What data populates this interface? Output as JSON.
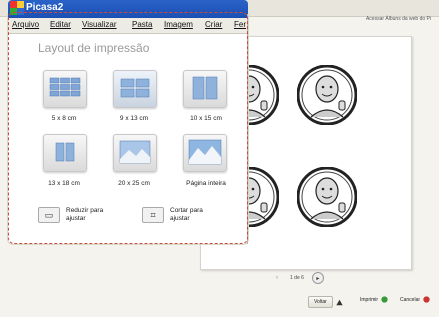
{
  "app": {
    "title": "Picasa2"
  },
  "menu": [
    "Arquivo",
    "Editar",
    "Visualizar",
    "Pasta",
    "Imagem",
    "Criar",
    "Fer"
  ],
  "heading": "Layout de impressão",
  "layouts": [
    {
      "label": "5 x 8 cm"
    },
    {
      "label": "9 x 13 cm"
    },
    {
      "label": "10 x 15 cm"
    },
    {
      "label": "13 x 18 cm"
    },
    {
      "label": "20 x 25 cm"
    },
    {
      "label": "Página inteira"
    }
  ],
  "options": {
    "shrink": "Reduzir para ajustar",
    "crop": "Cortar para ajustar"
  },
  "topright": "Acessar Álbuns da web do Pi",
  "pager": {
    "page": "1 de 6"
  },
  "actions": {
    "back": "Voltar",
    "print": "Imprimir",
    "cancel": "Cancelar"
  },
  "colors": {
    "titlebar": "#1b4fb3",
    "accent": "#c94c3b"
  }
}
